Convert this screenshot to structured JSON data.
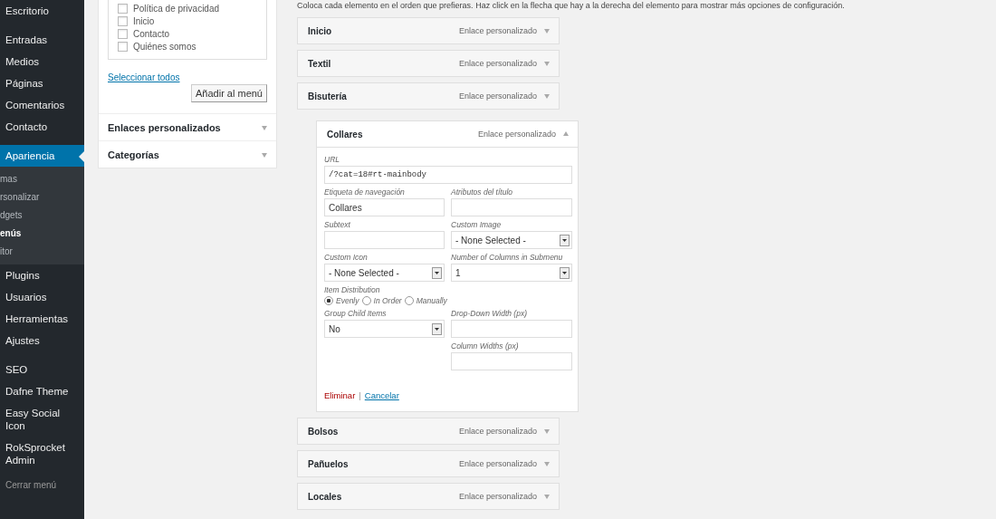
{
  "sidebar": {
    "groups": [
      [
        {
          "label": "Escritorio",
          "selected": false
        }
      ],
      [
        {
          "label": "Entradas",
          "selected": false
        },
        {
          "label": "Medios",
          "selected": false
        },
        {
          "label": "Páginas",
          "selected": false
        },
        {
          "label": "Comentarios",
          "selected": false
        },
        {
          "label": "Contacto",
          "selected": false
        }
      ],
      [
        {
          "label": "Apariencia",
          "selected": true,
          "children": [
            {
              "label": "mas",
              "selected": false
            },
            {
              "label": "rsonalizar",
              "selected": false
            },
            {
              "label": "dgets",
              "selected": false
            },
            {
              "label": "enús",
              "selected": true
            },
            {
              "label": "itor",
              "selected": false
            }
          ]
        },
        {
          "label": "Plugins",
          "selected": false
        },
        {
          "label": "Usuarios",
          "selected": false
        },
        {
          "label": "Herramientas",
          "selected": false
        },
        {
          "label": "Ajustes",
          "selected": false
        }
      ],
      [
        {
          "label": "SEO",
          "selected": false
        },
        {
          "label": "Dafne Theme",
          "selected": false
        },
        {
          "label": "Easy Social Icon",
          "selected": false
        },
        {
          "label": "RokSprocket Admin",
          "selected": false
        }
      ]
    ],
    "collapse": "Cerrar menú"
  },
  "pages_panel": {
    "checklist": [
      {
        "label": "Política de privacidad",
        "checked": false
      },
      {
        "label": "Inicio",
        "checked": false
      },
      {
        "label": "Contacto",
        "checked": false
      },
      {
        "label": "Quiénes somos",
        "checked": false
      }
    ],
    "select_all": "Seleccionar todos",
    "add_button": "Añadir al menú",
    "sections": [
      {
        "title": "Enlaces personalizados",
        "expanded": false
      },
      {
        "title": "Categorías",
        "expanded": false
      }
    ]
  },
  "menu_structure": {
    "instructions": "Coloca cada elemento en el orden que prefieras. Haz click en la flecha que hay a la derecha del elemento para mostrar más opciones de configuración.",
    "items": [
      {
        "title": "Inicio",
        "type": "Enlace personalizado",
        "expanded": false
      },
      {
        "title": "Textil",
        "type": "Enlace personalizado",
        "expanded": false
      },
      {
        "title": "Bisutería",
        "type": "Enlace personalizado",
        "expanded": false,
        "children": [
          {
            "title": "Collares",
            "type": "Enlace personalizado",
            "expanded": true,
            "rows": [
              {
                "full": {
                  "kind": "url",
                  "label": "URL",
                  "value": "/?cat=18#rt-mainbody"
                }
              },
              {
                "left": {
                  "kind": "text",
                  "label": "Etiqueta de navegación",
                  "value": "Collares"
                },
                "right": {
                  "kind": "text",
                  "label": "Atributos del título"
                }
              },
              {
                "left": {
                  "kind": "text",
                  "label": "Subtext"
                },
                "right": {
                  "kind": "select",
                  "label": "Custom Image",
                  "value": "- None Selected -"
                }
              },
              {
                "left": {
                  "kind": "select",
                  "label": "Custom Icon",
                  "value": "- None Selected -"
                },
                "right": {
                  "kind": "select",
                  "label": "Number of Columns in Submenu",
                  "value": "1"
                }
              },
              {
                "full": {
                  "kind": "radio",
                  "label": "Item Distribution",
                  "options": [
                    {
                      "label": "Evenly",
                      "selected": true
                    },
                    {
                      "label": "In Order",
                      "selected": false
                    },
                    {
                      "label": "Manually",
                      "selected": false
                    }
                  ]
                }
              },
              {
                "left": {
                  "kind": "select",
                  "label": "Group Child Items",
                  "value": "No"
                },
                "right": {
                  "kind": "text",
                  "label": "Drop-Down Width (px)"
                }
              },
              {
                "right": {
                  "kind": "text",
                  "label": "Column Widths (px)"
                }
              }
            ],
            "remove": "Eliminar",
            "separator": "|",
            "cancel": "Cancelar"
          }
        ]
      },
      {
        "title": "Bolsos",
        "type": "Enlace personalizado",
        "expanded": false
      },
      {
        "title": "Pañuelos",
        "type": "Enlace personalizado",
        "expanded": false
      },
      {
        "title": "Locales",
        "type": "Enlace personalizado",
        "expanded": false
      }
    ]
  }
}
